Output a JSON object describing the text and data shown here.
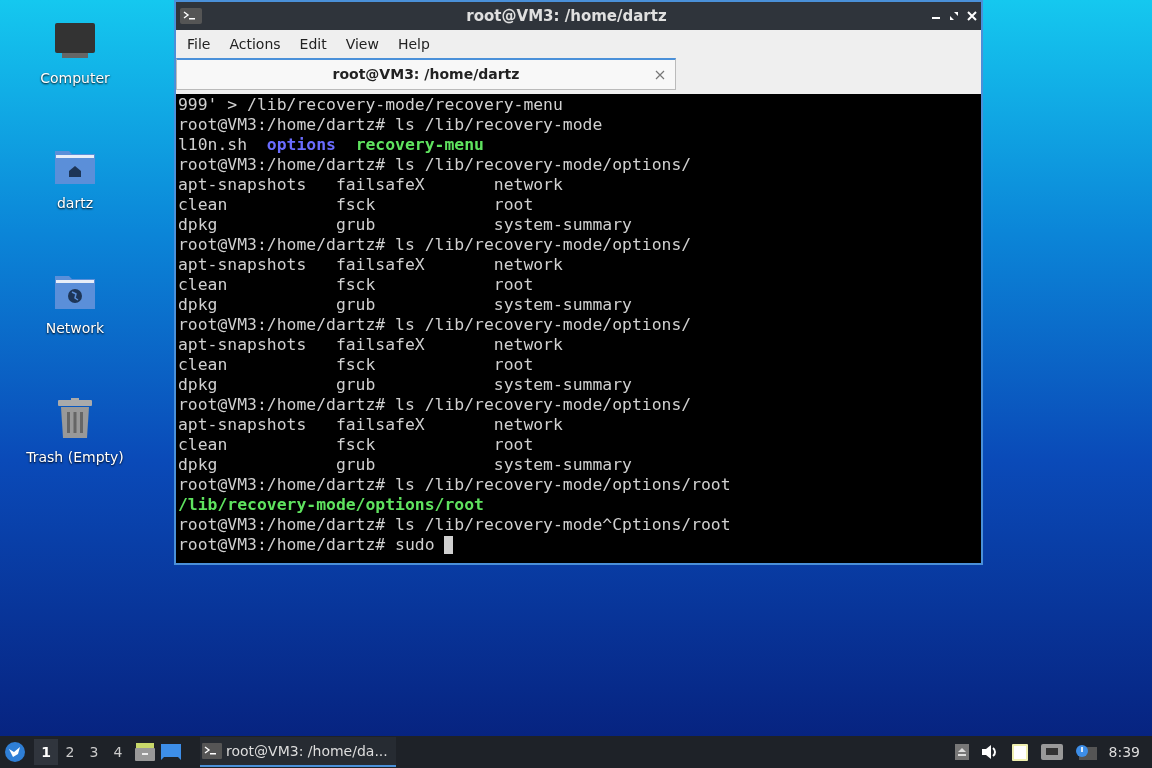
{
  "desktop_icons": [
    {
      "kind": "computer",
      "label": "Computer"
    },
    {
      "kind": "home",
      "label": "dartz"
    },
    {
      "kind": "network",
      "label": "Network"
    },
    {
      "kind": "trash",
      "label": "Trash (Empty)"
    }
  ],
  "window": {
    "title": "root@VM3: /home/dartz",
    "menu": [
      "File",
      "Actions",
      "Edit",
      "View",
      "Help"
    ],
    "tabs": [
      {
        "label": "root@VM3: /home/dartz",
        "selected": true
      }
    ],
    "terminal": {
      "lines": [
        [
          {
            "text": "999' > /lib/recovery-mode/recovery-menu",
            "kind": "plain"
          }
        ],
        [
          {
            "text": "root@VM3:/home/dartz# ls /lib/recovery-mode",
            "kind": "plain"
          }
        ],
        [
          {
            "text": "l10n.sh  ",
            "kind": "plain"
          },
          {
            "text": "options",
            "kind": "dir"
          },
          {
            "text": "  recovery-menu",
            "kind": "exec"
          }
        ],
        [
          {
            "text": "root@VM3:/home/dartz# ls /lib/recovery-mode/options/",
            "kind": "plain"
          }
        ],
        [
          {
            "text": "apt-snapshots   failsafeX       network",
            "kind": "plain"
          }
        ],
        [
          {
            "text": "clean           fsck            root",
            "kind": "plain"
          }
        ],
        [
          {
            "text": "dpkg            grub            system-summary",
            "kind": "plain"
          }
        ],
        [
          {
            "text": "root@VM3:/home/dartz# ls /lib/recovery-mode/options/",
            "kind": "plain"
          }
        ],
        [
          {
            "text": "apt-snapshots   failsafeX       network",
            "kind": "plain"
          }
        ],
        [
          {
            "text": "clean           fsck            root",
            "kind": "plain"
          }
        ],
        [
          {
            "text": "dpkg            grub            system-summary",
            "kind": "plain"
          }
        ],
        [
          {
            "text": "root@VM3:/home/dartz# ls /lib/recovery-mode/options/",
            "kind": "plain"
          }
        ],
        [
          {
            "text": "apt-snapshots   failsafeX       network",
            "kind": "plain"
          }
        ],
        [
          {
            "text": "clean           fsck            root",
            "kind": "plain"
          }
        ],
        [
          {
            "text": "dpkg            grub            system-summary",
            "kind": "plain"
          }
        ],
        [
          {
            "text": "root@VM3:/home/dartz# ls /lib/recovery-mode/options/",
            "kind": "plain"
          }
        ],
        [
          {
            "text": "apt-snapshots   failsafeX       network",
            "kind": "plain"
          }
        ],
        [
          {
            "text": "clean           fsck            root",
            "kind": "plain"
          }
        ],
        [
          {
            "text": "dpkg            grub            system-summary",
            "kind": "plain"
          }
        ],
        [
          {
            "text": "root@VM3:/home/dartz# ls /lib/recovery-mode/options/root",
            "kind": "plain"
          }
        ],
        [
          {
            "text": "/lib/recovery-mode/options/root",
            "kind": "exec"
          }
        ],
        [
          {
            "text": "root@VM3:/home/dartz# ls /lib/recovery-mode^Cptions/root",
            "kind": "plain"
          }
        ],
        [
          {
            "text": "root@VM3:/home/dartz# sudo ",
            "kind": "plain"
          }
        ]
      ],
      "cursor": true
    }
  },
  "taskbar": {
    "workspaces": [
      {
        "label": "1",
        "selected": true
      },
      {
        "label": "2",
        "selected": false
      },
      {
        "label": "3",
        "selected": false
      },
      {
        "label": "4",
        "selected": false
      }
    ],
    "tasks": [
      {
        "label": "root@VM3: /home/da...",
        "selected": true
      }
    ],
    "clock": "8:39"
  }
}
